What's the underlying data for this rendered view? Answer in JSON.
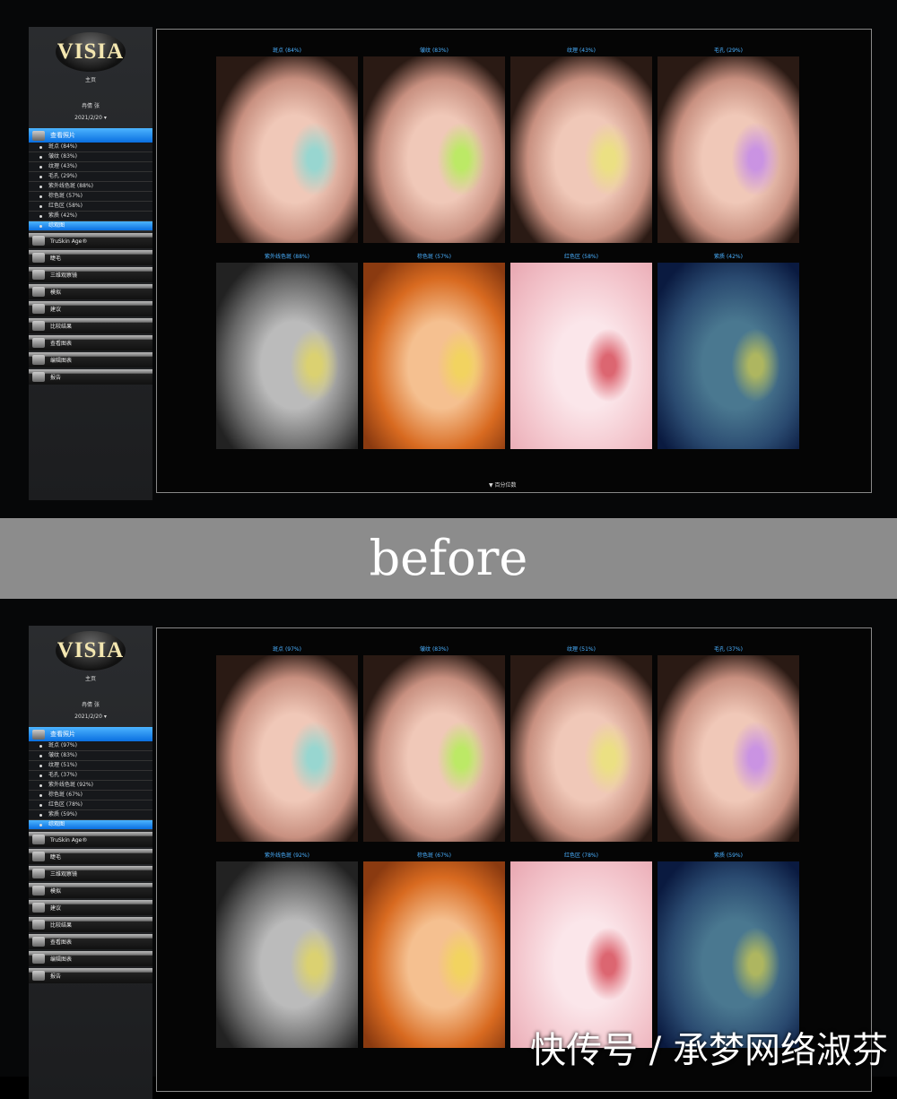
{
  "band_label": "before",
  "watermark": "快传号 / 承梦网络淑芬",
  "screens": [
    {
      "logo": "VISIA",
      "home": "主页",
      "user": "冉倩 张",
      "date": "2021/2/20 ▾",
      "view": "查看照片",
      "items": [
        "斑点 (84%)",
        "皱纹 (83%)",
        "纹理 (43%)",
        "毛孔 (29%)",
        "紫外线色斑 (88%)",
        "棕色斑 (57%)",
        "红色区 (58%)",
        "紫质 (42%)",
        "综观图"
      ],
      "menu": [
        "TruSkin Age®",
        "睫毛",
        "三维观察镜",
        "模拟",
        "建议",
        "比较结果",
        "查看图表",
        "编辑图表",
        "报告"
      ],
      "captions": [
        "斑点 (84%)",
        "皱纹 (83%)",
        "纹理 (43%)",
        "毛孔 (29%)",
        "紫外线色斑 (88%)",
        "棕色斑 (57%)",
        "红色区 (58%)",
        "紫质 (42%)"
      ],
      "footer": "▼ 百分位数"
    },
    {
      "logo": "VISIA",
      "home": "主页",
      "user": "冉倩 张",
      "date": "2021/2/20 ▾",
      "view": "查看照片",
      "items": [
        "斑点 (97%)",
        "皱纹 (83%)",
        "纹理 (51%)",
        "毛孔 (37%)",
        "紫外线色斑 (92%)",
        "棕色斑 (67%)",
        "红色区 (78%)",
        "紫质 (59%)",
        "综观图"
      ],
      "menu": [
        "TruSkin Age®",
        "睫毛",
        "三维观察镜",
        "模拟",
        "建议",
        "比较结果",
        "查看图表",
        "编辑图表",
        "报告"
      ],
      "captions": [
        "斑点 (97%)",
        "皱纹 (83%)",
        "纹理 (51%)",
        "毛孔 (37%)",
        "紫外线色斑 (92%)",
        "棕色斑 (67%)",
        "红色区 (78%)",
        "紫质 (59%)"
      ],
      "footer": ""
    }
  ],
  "spot_colors": [
    "#5ee0e0",
    "#9aff30",
    "#e8f060",
    "#b070ff",
    "#f0e040",
    "#f0e040",
    "#c81020",
    "#f0e040"
  ]
}
